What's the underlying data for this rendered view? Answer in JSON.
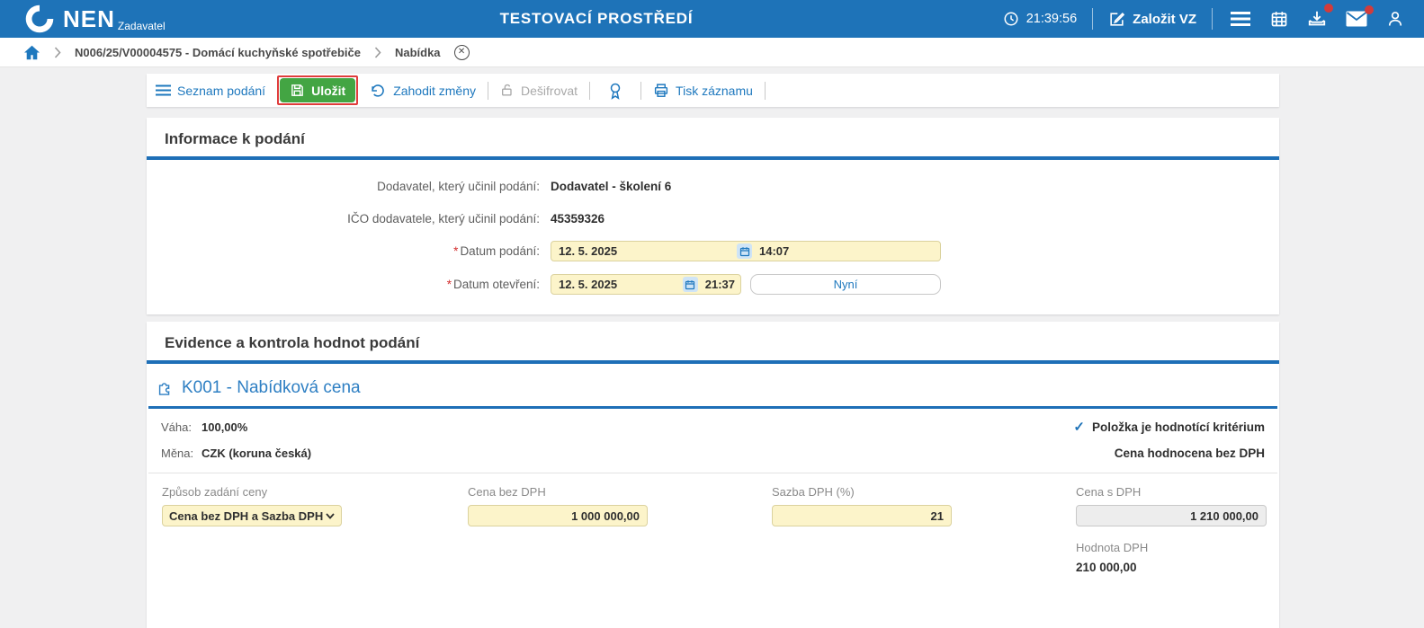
{
  "header": {
    "brand": "NEN",
    "brand_sub": "Zadavatel",
    "env_title": "TESTOVACÍ PROSTŘEDÍ",
    "time": "21:39:56",
    "create_vz": "Založit VZ"
  },
  "breadcrumb": {
    "item_contract": "N006/25/V00004575 - Domácí kuchyňské spotřebiče",
    "item_current": "Nabídka",
    "close_glyph": "✕"
  },
  "toolbar": {
    "seznam_podani": "Seznam podání",
    "ulozit": "Uložit",
    "zahodit_zmeny": "Zahodit změny",
    "desifrovat": "Dešifrovat",
    "tisk_zaznamu": "Tisk záznamu"
  },
  "info": {
    "title": "Informace k podání",
    "required_mark": "*",
    "dodavatel_label": "Dodavatel, který učinil podání:",
    "dodavatel_value": "Dodavatel - školení 6",
    "ico_label": "IČO dodavatele, který učinil podání:",
    "ico_value": "45359326",
    "datum_podani_label": "Datum podání:",
    "datum_podani_date": "12. 5. 2025",
    "datum_podani_time": "14:07",
    "datum_otevreni_label": "Datum otevření:",
    "datum_otevreni_date": "12. 5. 2025",
    "datum_otevreni_time": "21:37",
    "nyni": "Nyní"
  },
  "evidence": {
    "title": "Evidence a kontrola hodnot podání",
    "k001_title": "K001 - Nabídková cena",
    "vaha_label": "Váha:",
    "vaha_value": "100,00%",
    "mena_label": "Měna:",
    "mena_value": "CZK (koruna česká)",
    "check_glyph": "✓",
    "flag_kriterium": "Položka je hodnotící kritérium",
    "flag_bez_dph": "Cena hodnocena bez DPH",
    "zpusob_label": "Způsob zadání ceny",
    "zpusob_value": "Cena bez DPH a Sazba DPH",
    "cena_bez_dph_label": "Cena bez DPH",
    "cena_bez_dph_value": "1 000 000,00",
    "sazba_dph_label": "Sazba DPH (%)",
    "sazba_dph_value": "21",
    "cena_s_dph_label": "Cena s DPH",
    "cena_s_dph_value": "1 210 000,00",
    "hodnota_dph_label": "Hodnota DPH",
    "hodnota_dph_value": "210 000,00"
  },
  "colors": {
    "header_blue": "#1E73B8",
    "link_blue": "#1E78BE",
    "save_green": "#43A543",
    "annotation_red": "#E03C3C",
    "input_yellow": "#FCF4CA",
    "badge_red": "#D23B3B"
  }
}
